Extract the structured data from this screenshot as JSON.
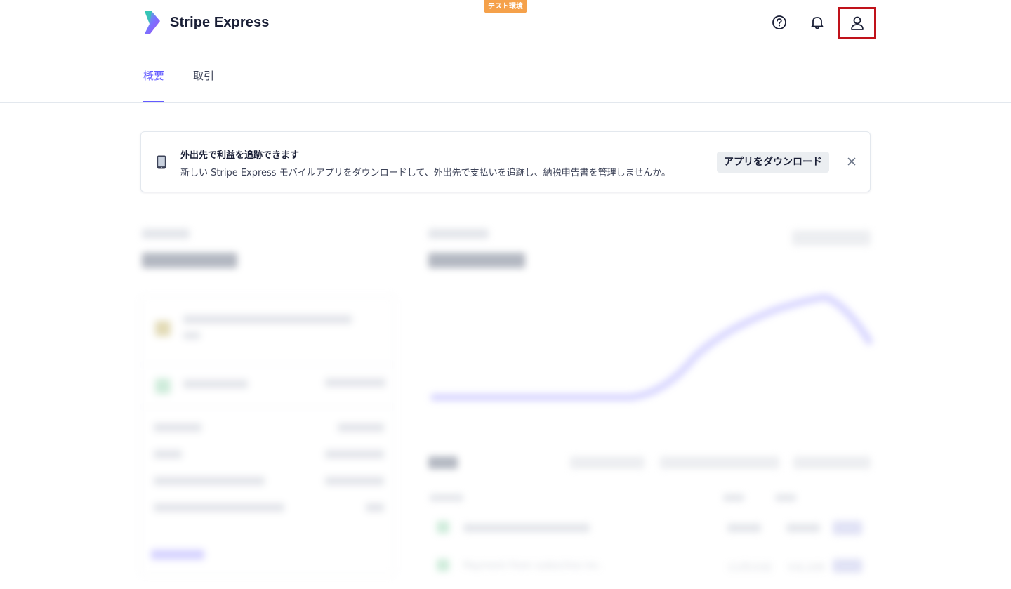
{
  "header": {
    "brand_name": "Stripe Express",
    "env_badge": "テスト環境",
    "icons": [
      "help-icon",
      "bell-icon",
      "account-icon"
    ]
  },
  "tabs": [
    {
      "label": "概要",
      "active": true
    },
    {
      "label": "取引",
      "active": false
    }
  ],
  "banner": {
    "title": "外出先で利益を追跡できます",
    "text": "新しい Stripe Express モバイルアプリをダウンロードして、外出先で支払いを追跡し、納税申告書を管理しませんか。",
    "button": "アプリをダウンロード"
  },
  "blurred_content": {
    "row_label": "Payment from subscline inc.",
    "row_date": "11月15日",
    "row_amount": "￥8,109"
  },
  "colors": {
    "accent": "#635bff",
    "badge": "#f5a14a",
    "highlight_border": "#c0121a"
  }
}
